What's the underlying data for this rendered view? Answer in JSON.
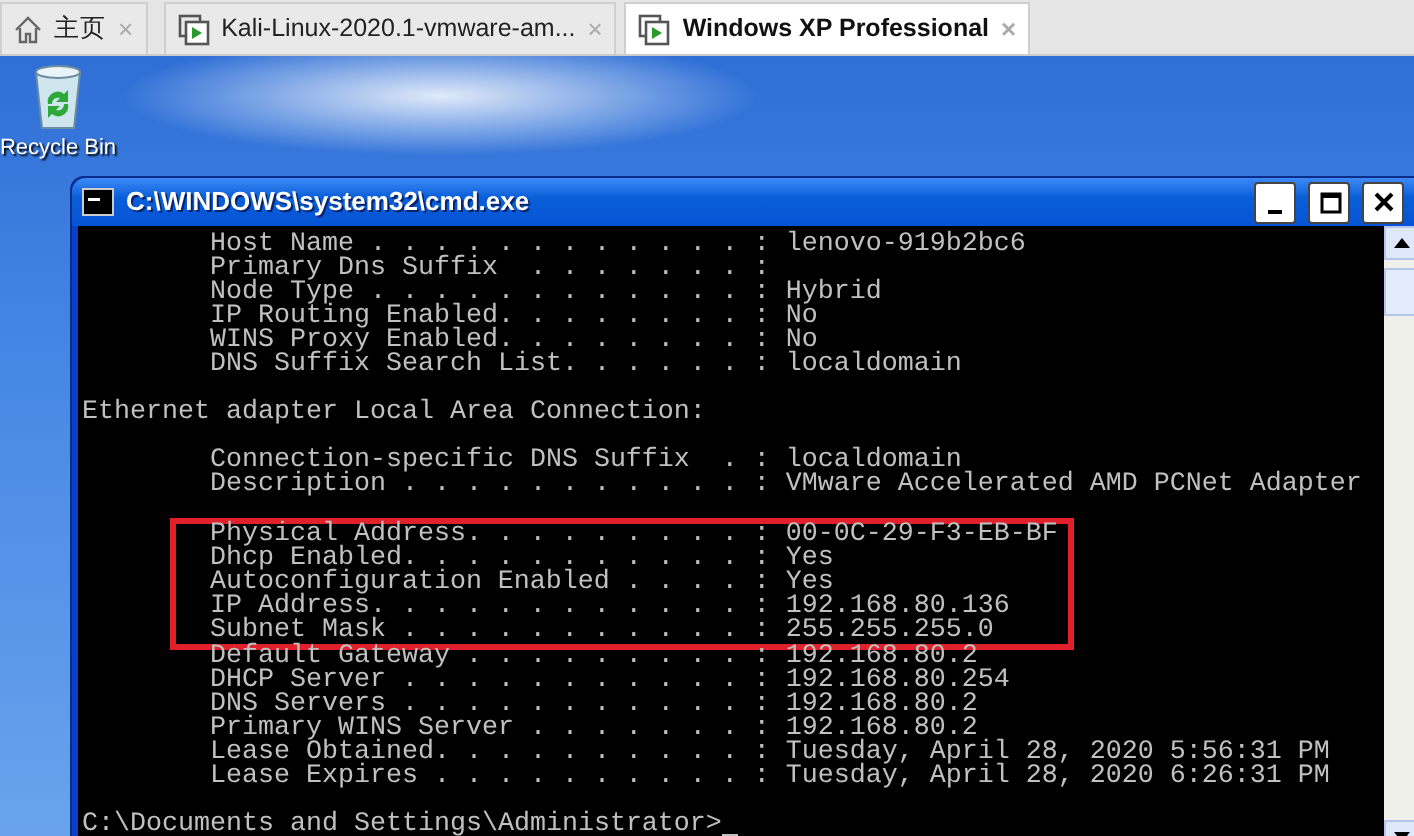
{
  "browser_tabs": [
    {
      "kind": "home",
      "label": "主页",
      "close": "×",
      "selected": false
    },
    {
      "kind": "vm",
      "label": "Kali-Linux-2020.1-vmware-am...",
      "close": "×",
      "selected": false
    },
    {
      "kind": "vm",
      "label": "Windows XP Professional",
      "close": "×",
      "selected": true
    }
  ],
  "desktop_icons": [
    {
      "label": "Recycle Bin"
    }
  ],
  "console_window": {
    "title": "C:\\WINDOWS\\system32\\cmd.exe",
    "lines": [
      {
        "kind": "field",
        "label": "Host Name . . . . . . . . . . . . :",
        "value": "lenovo-919b2bc6",
        "highlighted": false
      },
      {
        "kind": "field",
        "label": "Primary Dns Suffix  . . . . . . . :",
        "highlighted": false
      },
      {
        "kind": "field",
        "label": "Node Type . . . . . . . . . . . . :",
        "value": "Hybrid",
        "highlighted": false
      },
      {
        "kind": "field",
        "label": "IP Routing Enabled. . . . . . . . :",
        "value": "No",
        "highlighted": false
      },
      {
        "kind": "field",
        "label": "WINS Proxy Enabled. . . . . . . . :",
        "value": "No",
        "highlighted": false
      },
      {
        "kind": "field",
        "label": "DNS Suffix Search List. . . . . . :",
        "value": "localdomain",
        "highlighted": false
      },
      {
        "kind": "blank"
      },
      {
        "kind": "heading",
        "text": "Ethernet adapter Local Area Connection:"
      },
      {
        "kind": "blank"
      },
      {
        "kind": "field",
        "label": "Connection-specific DNS Suffix  . :",
        "value": "localdomain",
        "highlighted": false
      },
      {
        "kind": "field",
        "label": "Description . . . . . . . . . . . :",
        "value": "VMware Accelerated AMD PCNet Adapter",
        "highlighted": false
      },
      {
        "kind": "blank"
      },
      {
        "kind": "field",
        "label": "Physical Address. . . . . . . . . :",
        "value": "00-0C-29-F3-EB-BF",
        "highlighted": true
      },
      {
        "kind": "field",
        "label": "Dhcp Enabled. . . . . . . . . . . :",
        "value": "Yes",
        "highlighted": true
      },
      {
        "kind": "field",
        "label": "Autoconfiguration Enabled . . . . :",
        "value": "Yes",
        "highlighted": true
      },
      {
        "kind": "field",
        "label": "IP Address. . . . . . . . . . . . :",
        "value": "192.168.80.136",
        "highlighted": true
      },
      {
        "kind": "field",
        "label": "Subnet Mask . . . . . . . . . . . :",
        "value": "255.255.255.0",
        "highlighted": true
      },
      {
        "kind": "field",
        "label": "Default Gateway . . . . . . . . . :",
        "value": "192.168.80.2",
        "highlighted": false
      },
      {
        "kind": "field",
        "label": "DHCP Server . . . . . . . . . . . :",
        "value": "192.168.80.254",
        "highlighted": false
      },
      {
        "kind": "field",
        "label": "DNS Servers . . . . . . . . . . . :",
        "value": "192.168.80.2",
        "highlighted": false
      },
      {
        "kind": "field",
        "label": "Primary WINS Server . . . . . . . :",
        "value": "192.168.80.2",
        "highlighted": false
      },
      {
        "kind": "field",
        "label": "Lease Obtained. . . . . . . . . . :",
        "value": "Tuesday, April 28, 2020 5:56:31 PM",
        "highlighted": false
      },
      {
        "kind": "field",
        "label": "Lease Expires . . . . . . . . . . :",
        "value": "Tuesday, April 28, 2020 6:26:31 PM",
        "highlighted": false
      },
      {
        "kind": "blank"
      },
      {
        "kind": "prompt",
        "text": "C:\\Documents and Settings\\Administrator>"
      }
    ]
  }
}
